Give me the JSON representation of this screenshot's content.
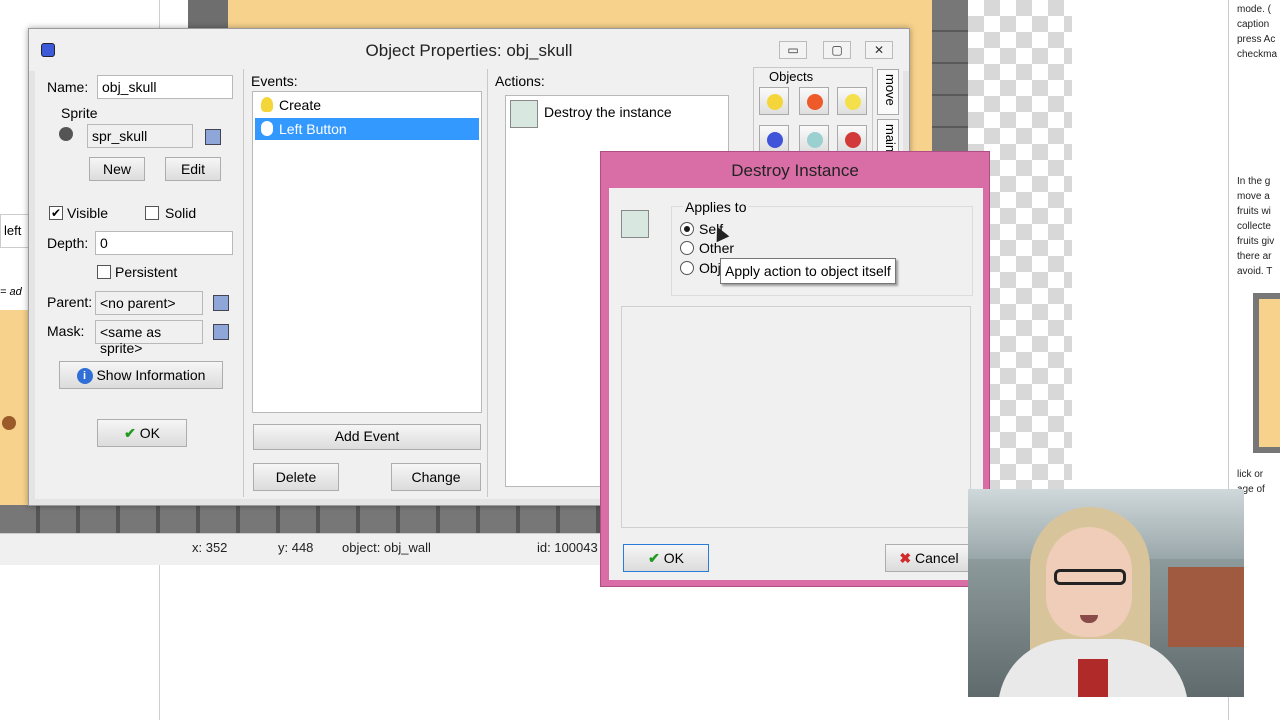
{
  "background": {
    "left_label": "left",
    "left_note": "= ad",
    "status": {
      "x": "x: 352",
      "y": "y: 448",
      "object": "object: obj_wall",
      "id": "id: 100043"
    },
    "doc_lines_top": [
      "mode. (",
      "caption",
      "press Ac",
      "checkma"
    ],
    "doc_lines_mid": [
      "In the g",
      "move a",
      "fruits wi",
      "collecte",
      "fruits giv",
      "there ar",
      "avoid. T"
    ],
    "doc_lines_bottom": [
      "lick or",
      "age of"
    ]
  },
  "object_window": {
    "title": "Object Properties: obj_skull",
    "window_buttons": {
      "minimize": "▭",
      "maximize": "▢",
      "close": "✕"
    },
    "name_label": "Name:",
    "name_value": "obj_skull",
    "sprite_label": "Sprite",
    "sprite_value": "spr_skull",
    "new_label": "New",
    "edit_label": "Edit",
    "visible_label": "Visible",
    "visible_checked": true,
    "solid_label": "Solid",
    "solid_checked": false,
    "depth_label": "Depth:",
    "depth_value": "0",
    "persistent_label": "Persistent",
    "persistent_checked": false,
    "parent_label": "Parent:",
    "parent_value": "<no parent>",
    "mask_label": "Mask:",
    "mask_value": "<same as sprite>",
    "show_info_label": "Show Information",
    "ok_label": "OK",
    "events_label": "Events:",
    "events": [
      {
        "label": "Create",
        "icon": "lightbulb-icon",
        "selected": false
      },
      {
        "label": "Left Button",
        "icon": "mouse-icon",
        "selected": true
      }
    ],
    "add_event_label": "Add Event",
    "delete_label": "Delete",
    "change_label": "Change",
    "actions_label": "Actions:",
    "actions": [
      {
        "label": "Destroy the instance",
        "icon": "destroy-instance-icon"
      }
    ],
    "objects_tab_label": "Objects",
    "vertical_tabs": [
      "move",
      "main"
    ]
  },
  "destroy_dialog": {
    "title": "Destroy Instance",
    "applies_to_label": "Applies to",
    "options": [
      {
        "label": "Self",
        "selected": true
      },
      {
        "label": "Other",
        "selected": false
      },
      {
        "label": "Obj",
        "selected": false
      }
    ],
    "ok_label": "OK",
    "cancel_label": "Cancel",
    "tooltip": "Apply action to object itself"
  }
}
